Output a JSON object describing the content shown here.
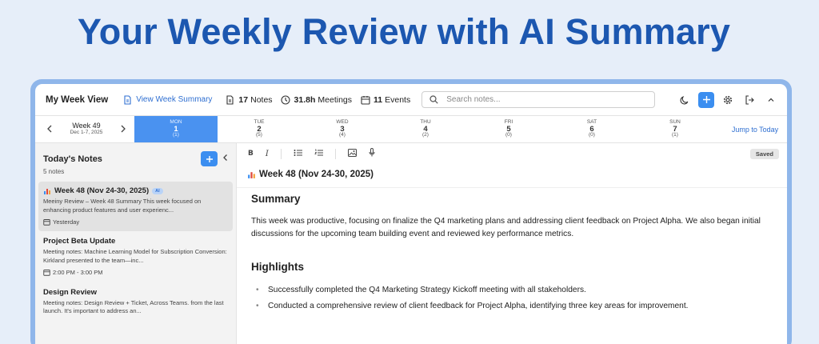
{
  "headline": "Your Weekly Review with AI Summary",
  "topbar": {
    "app_title": "My Week View",
    "summary_link": "View Week Summary",
    "notes_count": "17",
    "notes_label": "Notes",
    "meetings_hours": "31.8h",
    "meetings_label": "Meetings",
    "events_count": "11",
    "events_label": "Events",
    "search_placeholder": "Search notes..."
  },
  "week": {
    "label": "Week 49",
    "dates": "Dec 1-7, 2025",
    "jump_label": "Jump to Today",
    "days": [
      {
        "name": "MON",
        "date": "1",
        "count": "(1)",
        "selected": true
      },
      {
        "name": "TUE",
        "date": "2",
        "count": "(5)"
      },
      {
        "name": "WED",
        "date": "3",
        "count": "(4)"
      },
      {
        "name": "THU",
        "date": "4",
        "count": "(2)"
      },
      {
        "name": "FRI",
        "date": "5",
        "count": "(0)"
      },
      {
        "name": "SAT",
        "date": "6",
        "count": "(0)"
      },
      {
        "name": "SUN",
        "date": "7",
        "count": "(1)"
      }
    ]
  },
  "sidebar": {
    "title": "Today's Notes",
    "count": "5 notes",
    "notes": [
      {
        "title": "Week 48 (Nov 24-30, 2025)",
        "badge": "AI",
        "text": "Meeiny Review – Week 48 Summary This week focused on enhancing product features and user experienc...",
        "meta": "Yesterday"
      },
      {
        "title": "Project Beta Update",
        "text": "Meeting notes: Machine Learning Model for Subscription Conversion: Kirkland presented to the team—inc...",
        "meta": "2:00 PM - 3:00 PM"
      },
      {
        "title": "Design Review",
        "text": "Meeting notes: Design Review + Ticket, Across Teams. from the last launch. It's important to address an..."
      }
    ]
  },
  "editor": {
    "saved_label": "Saved",
    "doc_title": "Week 48 (Nov 24-30, 2025)",
    "summary_heading": "Summary",
    "summary_text": "This week was productive, focusing on finalize the Q4 marketing plans and addressing client feedback on Project Alpha. We also began initial discussions for the upcoming team building event and reviewed key performance metrics.",
    "highlights_heading": "Highlights",
    "highlights": [
      "Successfully completed the Q4 Marketing Strategy Kickoff meeting with all stakeholders.",
      "Conducted a comprehensive review of client feedback for Project Alpha, identifying three key areas for improvement."
    ]
  },
  "colors": {
    "accent": "#3b8ef0",
    "headline": "#1c57b0",
    "frame": "#8fb6ea"
  }
}
